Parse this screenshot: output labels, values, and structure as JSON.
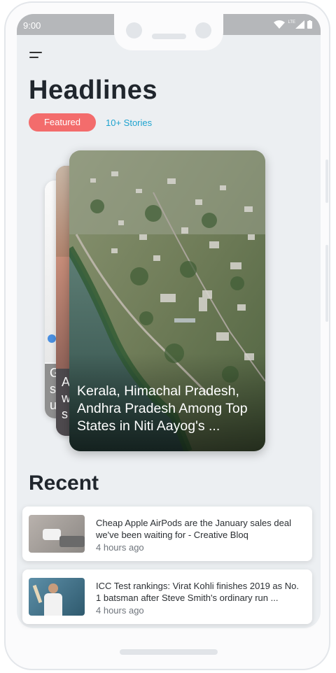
{
  "status_bar": {
    "time": "9:00",
    "network": "LTE"
  },
  "header": {
    "title": "Headlines",
    "tag": "Featured",
    "stories_count": "10+ Stories"
  },
  "carousel": {
    "main": {
      "title": "Kerala, Himachal Pradesh, Andhra Pradesh Among Top States in Niti Aayog's ..."
    },
    "back1": {
      "lines": [
        "A",
        "w",
        "s"
      ]
    },
    "back2": {
      "lines": [
        "G",
        "s",
        "u"
      ]
    }
  },
  "recent": {
    "title": "Recent",
    "items": [
      {
        "headline": "Cheap Apple AirPods are the January sales deal we've been waiting for - Creative Bloq",
        "time": "4 hours ago"
      },
      {
        "headline": "ICC Test rankings: Virat Kohli finishes 2019 as No. 1 batsman after Steve Smith's ordinary run ...",
        "time": "4 hours ago"
      }
    ]
  },
  "colors": {
    "accent": "#f36c6c",
    "link": "#1ea3cf",
    "title": "#20262d",
    "screen_bg": "#eceff2"
  }
}
